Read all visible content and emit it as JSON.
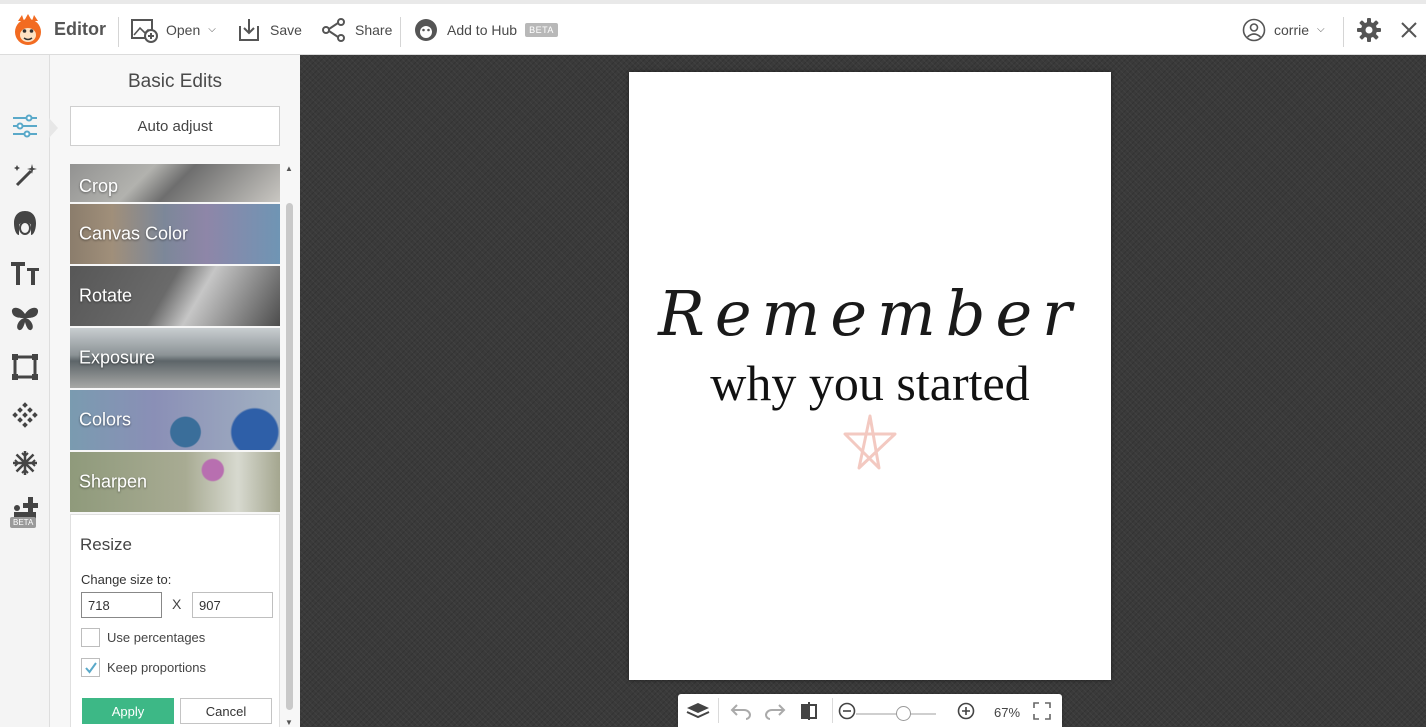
{
  "toolbar": {
    "app_name": "Editor",
    "open_label": "Open",
    "save_label": "Save",
    "share_label": "Share",
    "hub_label": "Add to Hub",
    "beta_label": "BETA",
    "user_name": "corrie"
  },
  "rail": {
    "icons": [
      "basic-edits-icon",
      "effects-wand-icon",
      "touch-up-face-icon",
      "text-icon",
      "overlays-butterfly-icon",
      "frames-icon",
      "textures-icon",
      "themes-snowflake-icon",
      "design-beta-icon"
    ],
    "beta_label": "BETA"
  },
  "panel": {
    "title": "Basic Edits",
    "auto_adjust_label": "Auto adjust",
    "tools": [
      "Crop",
      "Canvas Color",
      "Rotate",
      "Exposure",
      "Colors",
      "Sharpen"
    ],
    "resize": {
      "title": "Resize",
      "change_label": "Change size to:",
      "width_value": "718",
      "height_value": "907",
      "x_label": "X",
      "use_percentages_label": "Use percentages",
      "use_percentages_checked": false,
      "keep_proportions_label": "Keep proportions",
      "keep_proportions_checked": true,
      "apply_label": "Apply",
      "cancel_label": "Cancel"
    }
  },
  "canvas": {
    "line1": "Remember",
    "line2": "why you started"
  },
  "bottom": {
    "zoom_label": "67%",
    "zoom_level": 0.67
  },
  "colors": {
    "accent_green": "#3db886",
    "rail_active": "#5aa9c9",
    "workspace_bg": "#3a3a3a",
    "star_pink": "#f3c9c1"
  }
}
